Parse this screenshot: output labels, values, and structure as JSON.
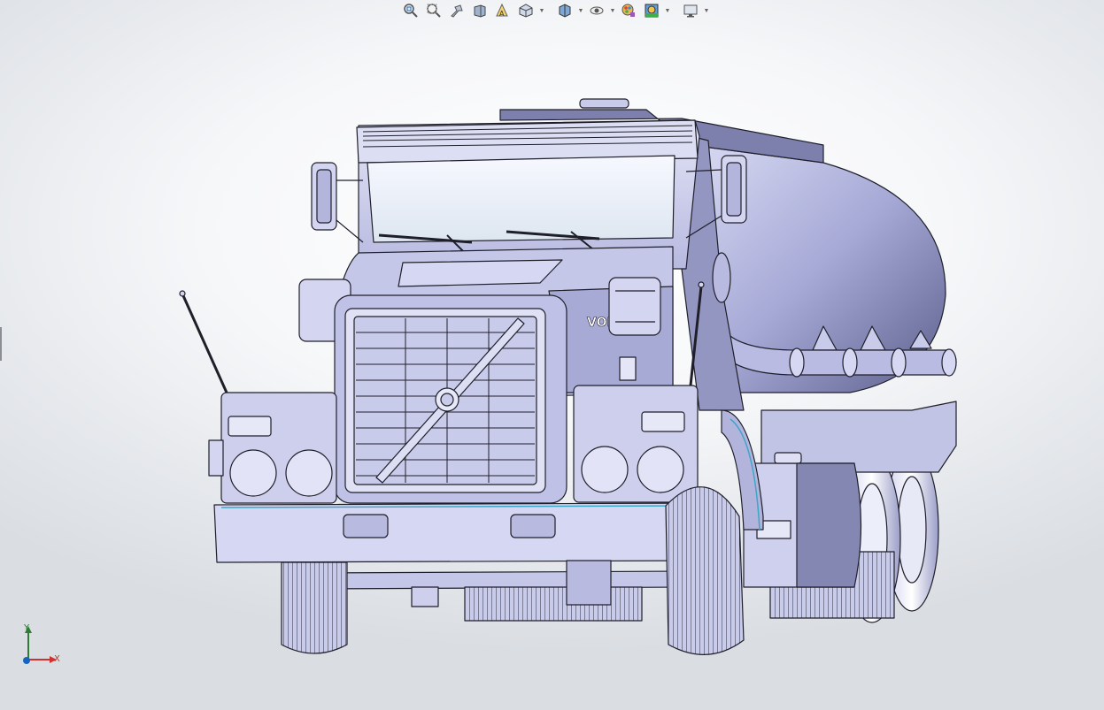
{
  "toolbar": {
    "buttons": [
      {
        "icon": "zoom-to-fit-icon",
        "dropdown": false
      },
      {
        "icon": "zoom-to-area-icon",
        "dropdown": false
      },
      {
        "icon": "previous-view-icon",
        "dropdown": false
      },
      {
        "icon": "section-view-icon",
        "dropdown": false
      },
      {
        "icon": "dynamic-annotation-icon",
        "dropdown": false
      },
      {
        "icon": "view-orientation-icon",
        "dropdown": true
      },
      {
        "icon": "display-style-icon",
        "dropdown": true
      },
      {
        "icon": "hide-show-items-icon",
        "dropdown": true
      },
      {
        "icon": "edit-appearance-icon",
        "dropdown": false
      },
      {
        "icon": "apply-scene-icon",
        "dropdown": true
      },
      {
        "icon": "view-settings-icon",
        "dropdown": true
      }
    ]
  },
  "model": {
    "name": "tanker-truck-model",
    "body_color": "#c9cbea",
    "edge_color": "#1f1f2a"
  },
  "triad": {
    "x_label": "X",
    "y_label": "Y",
    "x_color": "#d32f2f",
    "y_color": "#2e7d32",
    "z_color": "#1565c0"
  }
}
